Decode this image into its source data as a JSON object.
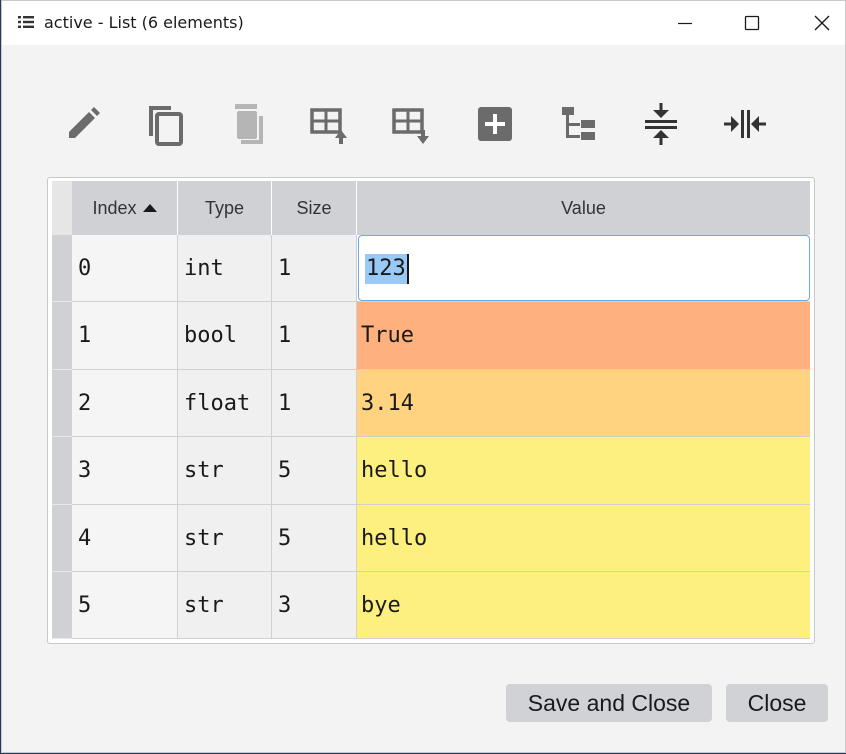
{
  "window": {
    "title": "active - List (6 elements)",
    "icon": "list-icon"
  },
  "toolbar": {
    "icons": [
      "edit-icon",
      "copy-icon",
      "delete-icon",
      "insert-above-icon",
      "insert-below-icon",
      "add-icon",
      "tree-icon",
      "collapse-icon",
      "expand-icon"
    ]
  },
  "table": {
    "headers": {
      "index": "Index",
      "type": "Type",
      "size": "Size",
      "value": "Value"
    },
    "sort": {
      "column": "Index",
      "direction": "ascending"
    },
    "rows": [
      {
        "index": "0",
        "type": "int",
        "size": "1",
        "value": "123",
        "color": "#ffffff"
      },
      {
        "index": "1",
        "type": "bool",
        "size": "1",
        "value": "True",
        "color": "#ffb07f"
      },
      {
        "index": "2",
        "type": "float",
        "size": "1",
        "value": "3.14",
        "color": "#ffd37f"
      },
      {
        "index": "3",
        "type": "str",
        "size": "5",
        "value": "hello",
        "color": "#fdf07f"
      },
      {
        "index": "4",
        "type": "str",
        "size": "5",
        "value": "hello",
        "color": "#fdf07f"
      },
      {
        "index": "5",
        "type": "str",
        "size": "3",
        "value": "bye",
        "color": "#fdf07f"
      }
    ],
    "editing_value": "123"
  },
  "buttons": {
    "save_close": "Save and Close",
    "close": "Close"
  }
}
